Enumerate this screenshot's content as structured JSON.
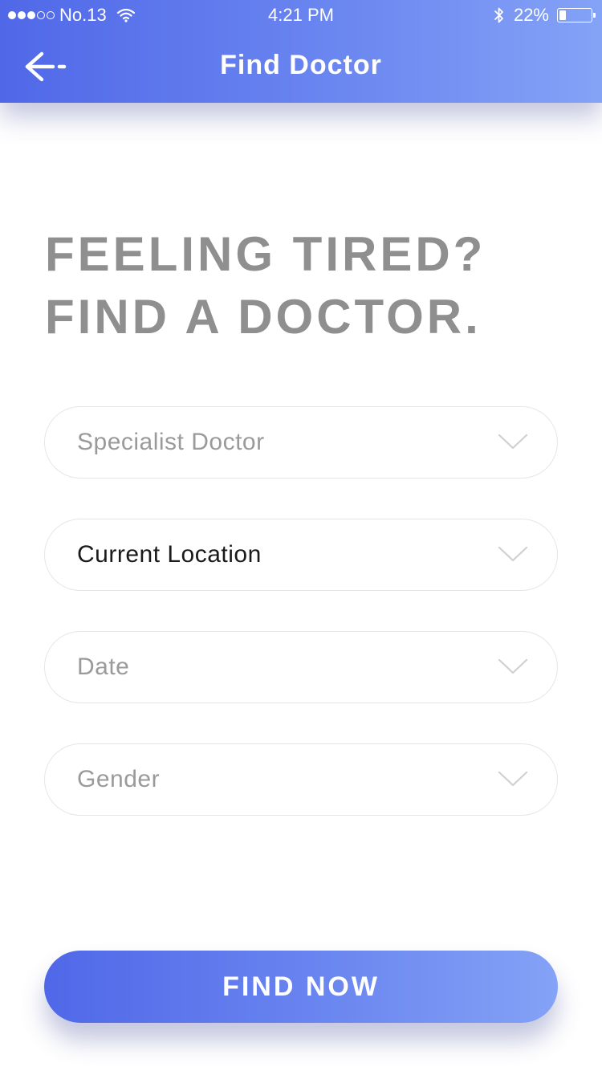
{
  "status_bar": {
    "carrier": "No.13",
    "time": "4:21 PM",
    "battery": "22%",
    "battery_level": 0.22,
    "signal_bars_filled": 3,
    "signal_bars_total": 5,
    "icons": [
      "wifi-icon",
      "bluetooth-icon",
      "battery-icon"
    ]
  },
  "header": {
    "title": "Find Doctor",
    "back_icon": "back-arrow-icon"
  },
  "headline": {
    "line1": "FEELING TIRED?",
    "line2": "FIND A DOCTOR."
  },
  "form": {
    "fields": [
      {
        "label": "Specialist Doctor",
        "state": "placeholder",
        "icon": "chevron-down-icon"
      },
      {
        "label": "Current Location",
        "state": "selected",
        "icon": "chevron-down-icon"
      },
      {
        "label": "Date",
        "state": "placeholder",
        "icon": "chevron-down-icon"
      },
      {
        "label": "Gender",
        "state": "placeholder",
        "icon": "chevron-down-icon"
      }
    ]
  },
  "action": {
    "button_label": "FIND NOW"
  },
  "colors": {
    "gradient_start": "#5068e8",
    "gradient_end": "#84a2f6",
    "headline": "#8f8f8f",
    "placeholder_text": "#9a9a9a",
    "selected_text": "#1a1a1a",
    "field_border": "#e6e6ea"
  }
}
